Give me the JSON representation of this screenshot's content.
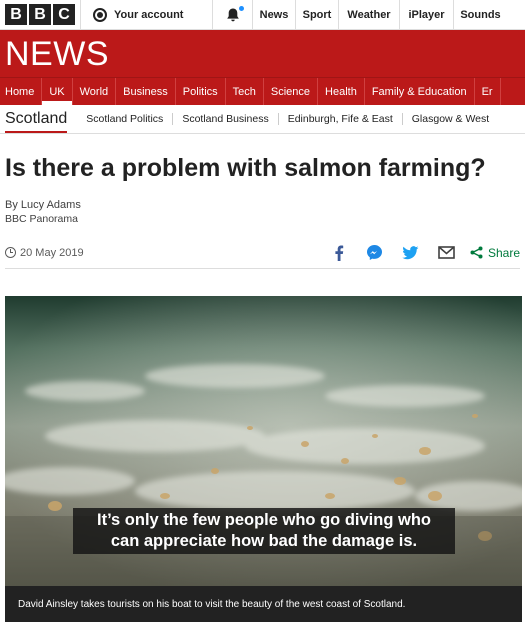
{
  "header": {
    "logo_letters": [
      "B",
      "B",
      "C"
    ],
    "account_label": "Your account",
    "nav": [
      {
        "label": "News",
        "width": 43
      },
      {
        "label": "Sport",
        "width": 43
      },
      {
        "label": "Weather",
        "width": 61
      },
      {
        "label": "iPlayer",
        "width": 54
      },
      {
        "label": "Sounds",
        "width": 54
      }
    ]
  },
  "news_logo": "NEWS",
  "navbar": {
    "items": [
      "Home",
      "UK",
      "World",
      "Business",
      "Politics",
      "Tech",
      "Science",
      "Health",
      "Family & Education",
      "Er"
    ],
    "active_index": 1
  },
  "subnav": {
    "title": "Scotland",
    "items": [
      "Scotland Politics",
      "Scotland Business",
      "Edinburgh, Fife & East",
      "Glasgow & West"
    ]
  },
  "article": {
    "headline": "Is there a problem with salmon farming?",
    "author": "By Lucy Adams",
    "author_role": "BBC Panorama",
    "date": "20 May 2019",
    "share_label": "Share"
  },
  "media": {
    "subtitle_line1": "It’s only the few people who go diving who",
    "subtitle_line2": "can appreciate how bad the damage is.",
    "caption": "David Ainsley takes tourists on his boat to visit the beauty of the west coast of Scotland."
  },
  "colors": {
    "brand_red": "#bb1919",
    "share_green": "#007a3d",
    "facebook_blue": "#3b5998",
    "twitter_blue": "#1da1f2"
  }
}
